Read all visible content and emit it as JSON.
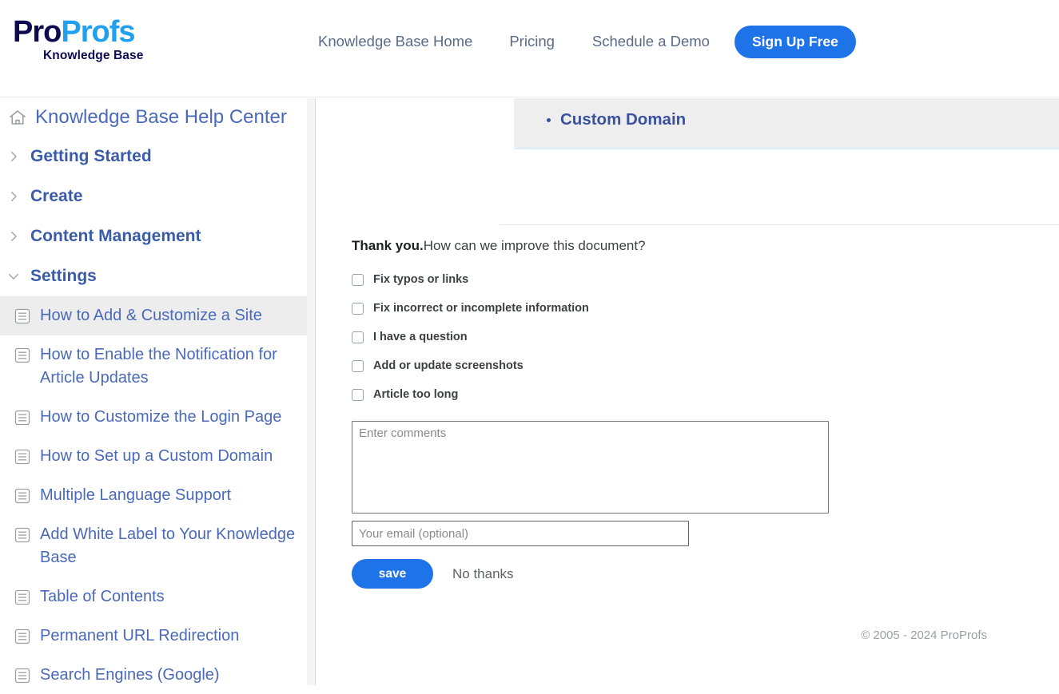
{
  "header": {
    "logo": {
      "part1": "Pro",
      "part2": "Profs",
      "subtitle": "Knowledge Base"
    },
    "nav": [
      {
        "label": "Knowledge Base Home"
      },
      {
        "label": "Pricing"
      },
      {
        "label": "Schedule a Demo"
      }
    ],
    "signup_label": "Sign Up Free",
    "colors": {
      "logo_dark": "#0d0a52",
      "logo_light": "#20a0ee",
      "accent_blue": "#1e73e8",
      "nav_text": "#5a6b86"
    }
  },
  "sidebar": {
    "home": {
      "label": "Knowledge Base Help Center",
      "icon": "home-icon"
    },
    "sections": [
      {
        "label": "Getting Started",
        "expanded": false,
        "icon": "chevron-right-icon"
      },
      {
        "label": "Create",
        "expanded": false,
        "icon": "chevron-right-icon"
      },
      {
        "label": "Content Management",
        "expanded": false,
        "icon": "chevron-right-icon"
      },
      {
        "label": "Settings",
        "expanded": true,
        "icon": "chevron-down-icon"
      }
    ],
    "articles": [
      {
        "label": "How to Add & Customize a Site",
        "active": true
      },
      {
        "label": "How to Enable the Notification for Article Updates",
        "active": false
      },
      {
        "label": "How to Customize the Login Page",
        "active": false
      },
      {
        "label": "How to Set up a Custom Domain",
        "active": false
      },
      {
        "label": "Multiple Language Support",
        "active": false
      },
      {
        "label": "Add White Label to Your Knowledge Base",
        "active": false
      },
      {
        "label": "Table of Contents",
        "active": false
      },
      {
        "label": "Permanent URL Redirection",
        "active": false
      },
      {
        "label": "Search Engines (Google)",
        "active": false
      }
    ],
    "colors": {
      "link": "#4a69b8",
      "section": "#3a5ba8",
      "active_bg": "#ededed"
    }
  },
  "content": {
    "related": {
      "items": [
        {
          "label": "Custom Domain"
        }
      ],
      "bg": "#eeeeee",
      "link_color": "#3a51a0"
    },
    "feedback": {
      "thanks": "Thank you.",
      "question": "How can we improve this document?",
      "options": [
        {
          "label": "Fix typos or links",
          "checked": false
        },
        {
          "label": "Fix incorrect or incomplete information",
          "checked": false
        },
        {
          "label": "I have a question",
          "checked": false
        },
        {
          "label": "Add or update screenshots",
          "checked": false
        },
        {
          "label": "Article too long",
          "checked": false
        }
      ],
      "comments_placeholder": "Enter comments",
      "comments_value": "",
      "email_placeholder": "Your email (optional)",
      "email_value": "",
      "save_label": "save",
      "no_thanks_label": "No thanks"
    },
    "copyright": "© 2005 - 2024 ProProfs"
  }
}
